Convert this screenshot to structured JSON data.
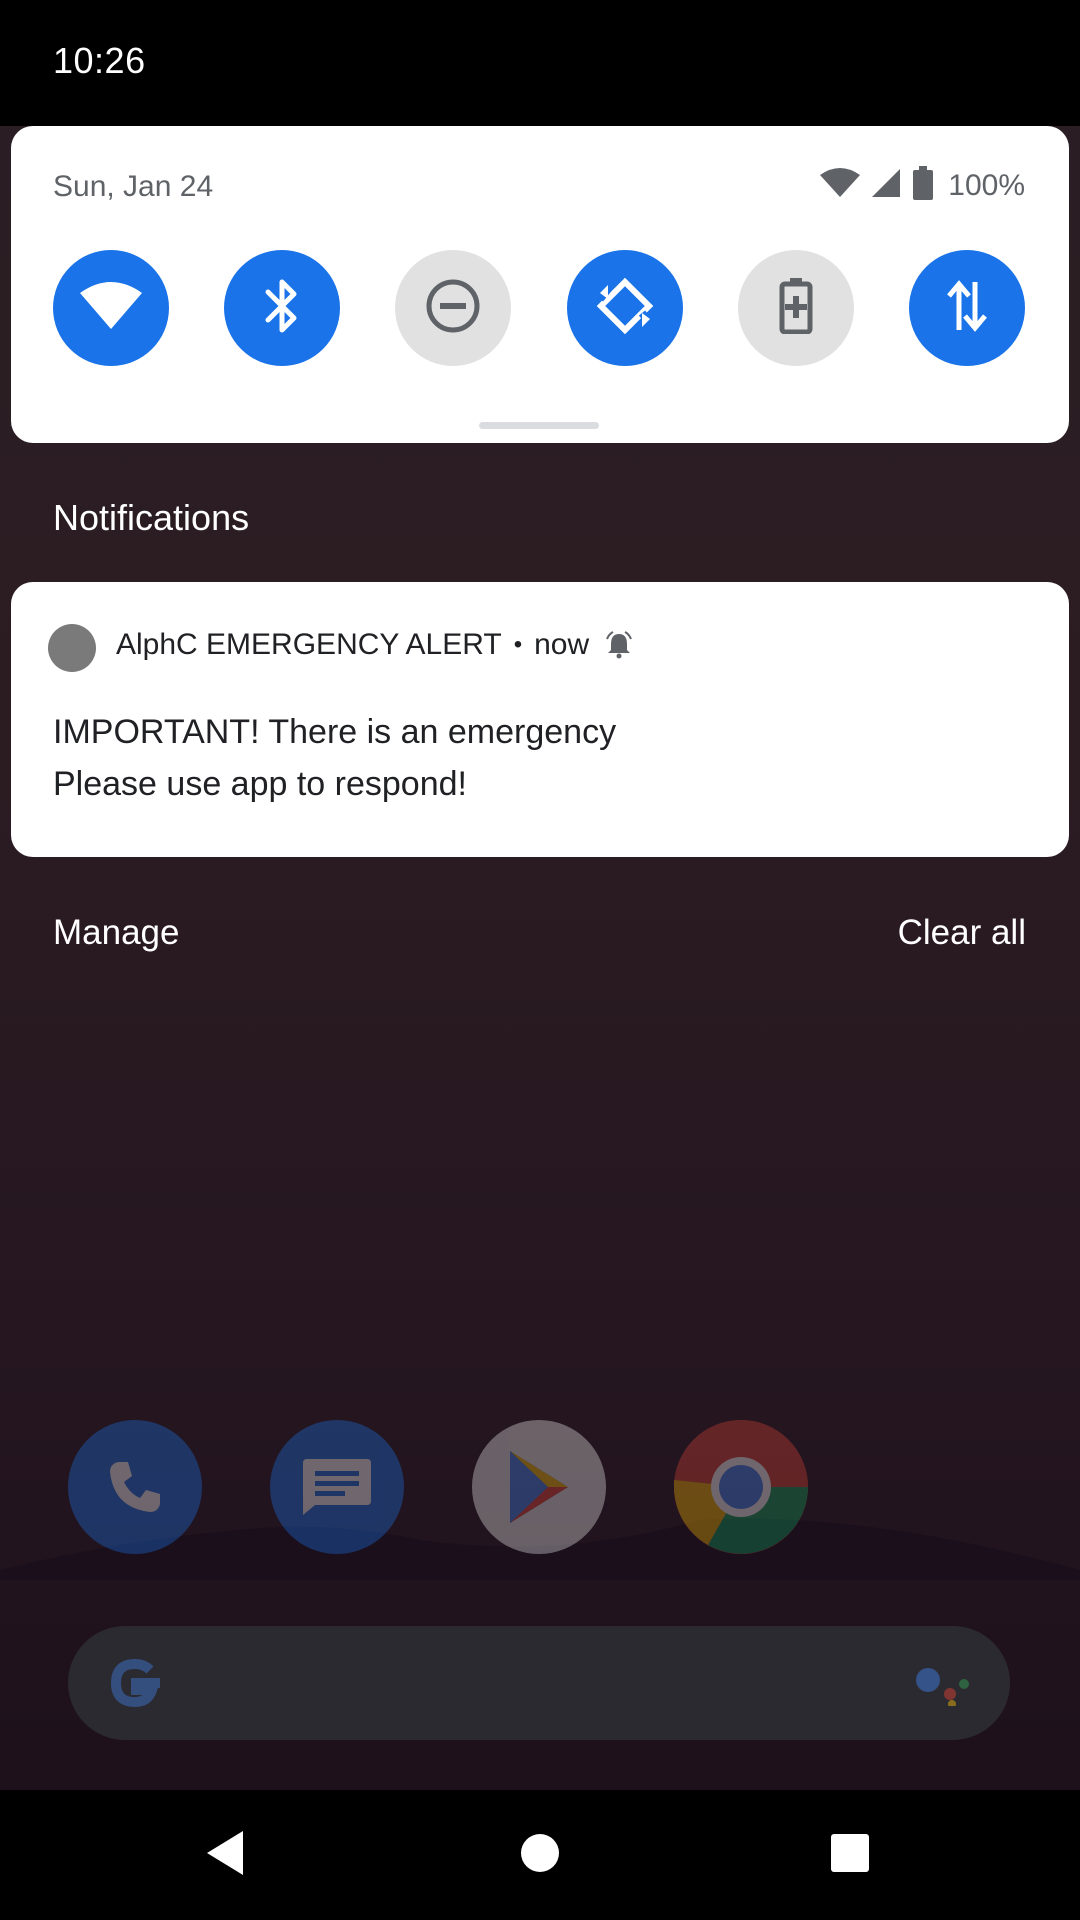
{
  "status_bar": {
    "time": "10:26"
  },
  "quick_settings": {
    "date": "Sun, Jan 24",
    "battery_percent": "100%",
    "tiles": [
      {
        "name": "wifi",
        "state": "on"
      },
      {
        "name": "bluetooth",
        "state": "on"
      },
      {
        "name": "do-not-disturb",
        "state": "off"
      },
      {
        "name": "auto-rotate",
        "state": "on"
      },
      {
        "name": "battery-saver",
        "state": "off"
      },
      {
        "name": "mobile-data",
        "state": "on"
      }
    ]
  },
  "notifications": {
    "header": "Notifications",
    "items": [
      {
        "app_name": "AlphC EMERGENCY ALERT",
        "separator": "•",
        "time": "now",
        "line1": "IMPORTANT! There is an emergency",
        "line2": "Please use app to respond!"
      }
    ],
    "manage_label": "Manage",
    "clear_all_label": "Clear all"
  },
  "dock": {
    "apps": [
      "phone",
      "messages",
      "play-store",
      "chrome"
    ]
  },
  "colors": {
    "accent": "#1a73e8",
    "tile_off": "#e1e1e1",
    "text_dark": "#202124",
    "text_muted": "#5f6368"
  }
}
